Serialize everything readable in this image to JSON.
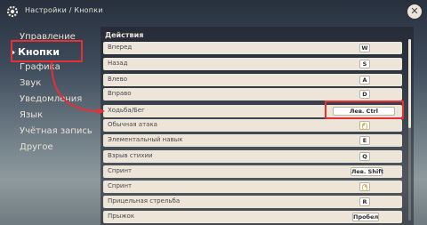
{
  "header": {
    "breadcrumb": "Настройки / Кнопки",
    "close_label": "✕"
  },
  "sidebar": {
    "items": [
      {
        "label": "Управление"
      },
      {
        "label": "Кнопки",
        "active": true
      },
      {
        "label": "Графика"
      },
      {
        "label": "Звук"
      },
      {
        "label": "Уведомления"
      },
      {
        "label": "Язык"
      },
      {
        "label": "Учётная запись"
      },
      {
        "label": "Другое"
      }
    ]
  },
  "main": {
    "section_title": "Действия",
    "rows": [
      {
        "action": "Вперед",
        "key": "W"
      },
      {
        "action": "Назад",
        "key": "S"
      },
      {
        "action": "Влево",
        "key": "A"
      },
      {
        "action": "Вправо",
        "key": "D"
      },
      {
        "action": "Ходьба/Бег",
        "key": "Лев. Ctrl"
      },
      {
        "action": "Обычная атака",
        "key": "",
        "key_icon": "mouse-left-icon"
      },
      {
        "action": "Элементальный навык",
        "key": "E"
      },
      {
        "action": "Взрыв стихии",
        "key": "Q"
      },
      {
        "action": "Спринт",
        "key": "Лев. Shift"
      },
      {
        "action": "Спринт",
        "key": "",
        "key_icon": "mouse-right-icon"
      },
      {
        "action": "Прицельная стрельба",
        "key": "R"
      },
      {
        "action": "Прыжок",
        "key": "Пробел"
      }
    ]
  },
  "colors": {
    "highlight": "#e53036",
    "row_bg": "#ece5d8",
    "text_light": "#ece5d8"
  }
}
